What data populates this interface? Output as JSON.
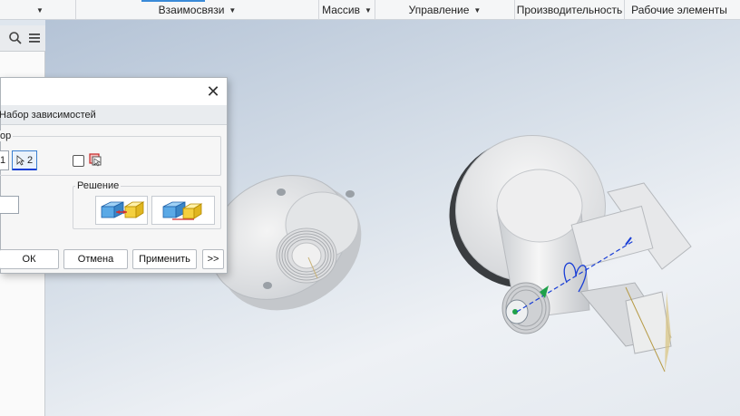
{
  "ribbon": {
    "groups": [
      {
        "label": "",
        "has_arrow": true
      },
      {
        "label": "Взаимосвязи",
        "has_arrow": true
      },
      {
        "label": "Массив",
        "has_arrow": true
      },
      {
        "label": "Управление",
        "has_arrow": true
      },
      {
        "label": "Производительность",
        "has_arrow": false
      },
      {
        "label": "Рабочие элементы",
        "has_arrow": false
      }
    ],
    "arrow_glyph": "▼",
    "accent_color": "#3a8ad8"
  },
  "browser": {
    "icons": [
      "search-icon",
      "menu-icon"
    ]
  },
  "dialog": {
    "close_glyph": "✕",
    "tab_label": "Набор зависимостей",
    "selection_legend": "ор",
    "select1_label": "1",
    "select2_label": "2",
    "solution_legend": "Решение",
    "ok_label": "ОК",
    "cancel_label": "Отмена",
    "apply_label": "Применить",
    "more_label": ">>"
  },
  "colors": {
    "part_light": "#ececec",
    "part_shadow": "#b9bdc2",
    "axis_blue": "#1a3fd6",
    "thread_color": "#cfd1d3",
    "solution_blue": "#5aa9e6",
    "solution_yellow": "#f4d03f"
  }
}
